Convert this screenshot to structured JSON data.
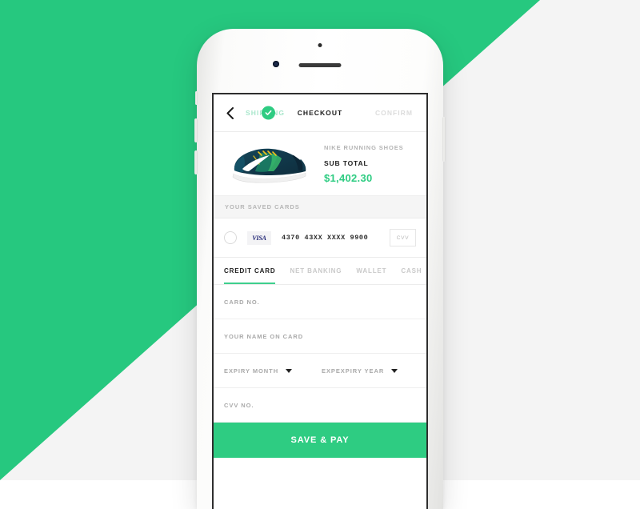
{
  "background": {
    "accent_color": "#26c87f",
    "base_color": "#f4f4f4"
  },
  "device": {
    "name": "iphone-white",
    "body_color": "#ffffff"
  },
  "app": {
    "header": {
      "back_icon": "chevron-left-icon",
      "steps": [
        {
          "label": "SHIPPING",
          "state": "completed",
          "color": "#a9e7cc"
        },
        {
          "label": "CHECKOUT",
          "state": "active",
          "color": "#1b1b1b"
        },
        {
          "label": "CONFIRM",
          "state": "pending",
          "color": "#dcdcdc"
        }
      ],
      "completed_badge_icon": "check-circle-icon"
    },
    "product": {
      "image_alt": "nike-running-shoe",
      "name": "NIKE RUNNING SHOES",
      "subtotal_label": "SUB TOTAL",
      "subtotal_value": "$1,402.30",
      "subtotal_color": "#2ecc82"
    },
    "saved_cards": {
      "section_title": "YOUR SAVED CARDS",
      "cards": [
        {
          "selected": false,
          "brand": "VISA",
          "number": "4370  43XX  XXXX  9900",
          "cvv_placeholder": "CVV"
        }
      ]
    },
    "payment_tabs": [
      {
        "label": "CREDIT CARD",
        "active": true
      },
      {
        "label": "NET BANKING",
        "active": false
      },
      {
        "label": "WALLET",
        "active": false
      },
      {
        "label": "CASH",
        "active": false
      }
    ],
    "form": {
      "card_number": {
        "label": "CARD NO.",
        "value": ""
      },
      "name_on_card": {
        "label": "YOUR NAME ON CARD",
        "value": ""
      },
      "expiry_month": {
        "label": "EXPIRY MONTH",
        "value": ""
      },
      "expiry_year": {
        "label": "EXPEXPIRY YEAR",
        "value": ""
      },
      "cvv": {
        "label": "CVV NO.",
        "value": ""
      }
    },
    "cta": {
      "label": "SAVE & PAY",
      "color": "#2ecc82"
    }
  }
}
